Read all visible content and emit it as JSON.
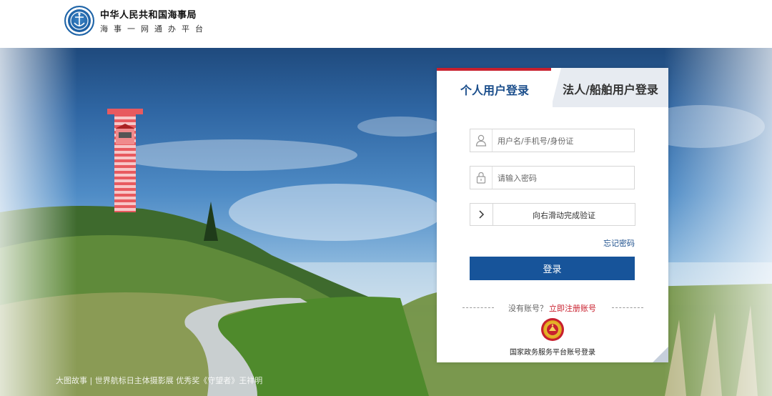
{
  "header": {
    "org_name": "中华人民共和国海事局",
    "org_subtitle": "海事一网通办平台",
    "logo_icon": "msa-emblem-icon"
  },
  "hero": {
    "caption": "大图故事 | 世界航标日主体摄影展 优秀奖《守望者》王祥明"
  },
  "login": {
    "tabs": [
      {
        "label": "个人用户登录",
        "active": true
      },
      {
        "label": "法人/船舶用户登录",
        "active": false
      }
    ],
    "username_placeholder": "用户名/手机号/身份证",
    "password_placeholder": "请输入密码",
    "slider_text": "向右滑动完成验证",
    "forgot_password": "忘记密码",
    "login_button": "登录",
    "no_account_text": "没有账号？",
    "register_link": "立即注册账号",
    "gov_login_text": "国家政务服务平台账号登录"
  },
  "colors": {
    "accent_blue": "#17549a",
    "tab_red": "#c9202e",
    "link_red": "#c9202e"
  }
}
